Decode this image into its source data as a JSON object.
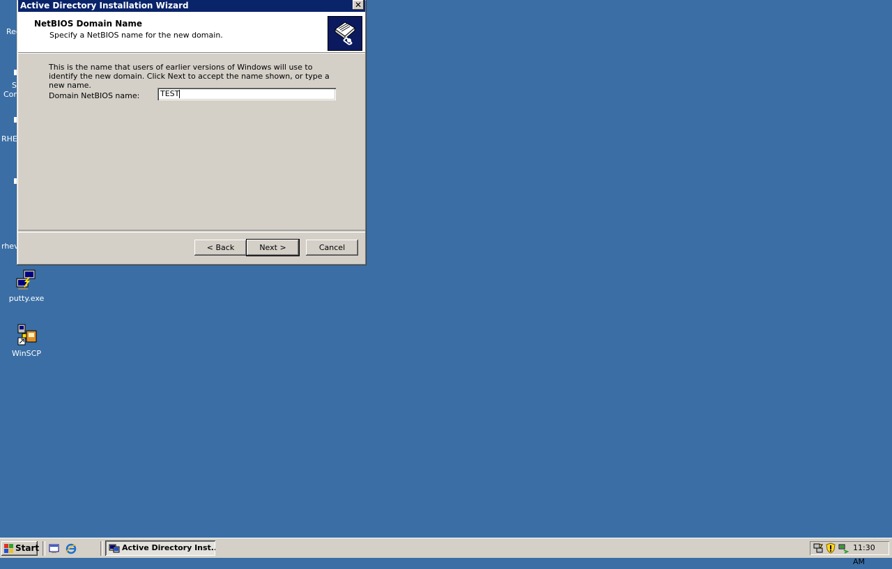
{
  "window": {
    "title": "Active Directory Installation Wizard",
    "close_label": "✕"
  },
  "header": {
    "title": "NetBIOS Domain Name",
    "subtitle": "Specify a NetBIOS name for the new domain."
  },
  "body": {
    "description": "This is the name that users of earlier versions of Windows will use to identify the new domain. Click Next to accept the name shown, or type a new name.",
    "field_label": "Domain NetBIOS name:",
    "field_value": "TEST"
  },
  "buttons": {
    "back": "< Back",
    "next": "Next >",
    "cancel": "Cancel"
  },
  "desktop": {
    "icons": [
      {
        "label": "putty.exe",
        "icon": "putty-icon"
      },
      {
        "label": "WinSCP",
        "icon": "winscp-icon"
      }
    ],
    "partial_labels": [
      "Rec",
      "S",
      "Con",
      "RHE",
      "rhev"
    ]
  },
  "taskbar": {
    "start_label": "Start",
    "active_task": "Active Directory Inst...",
    "quick_launch": [
      "show-desktop-icon",
      "internet-explorer-icon"
    ],
    "tray_icons": [
      "network-icon",
      "security-shield-icon",
      "connection-icon"
    ],
    "clock": "11:30 AM"
  },
  "colors": {
    "desktop": "#3a6ea5",
    "titlebar": "#0a246a",
    "dialog": "#d4d0c8"
  }
}
